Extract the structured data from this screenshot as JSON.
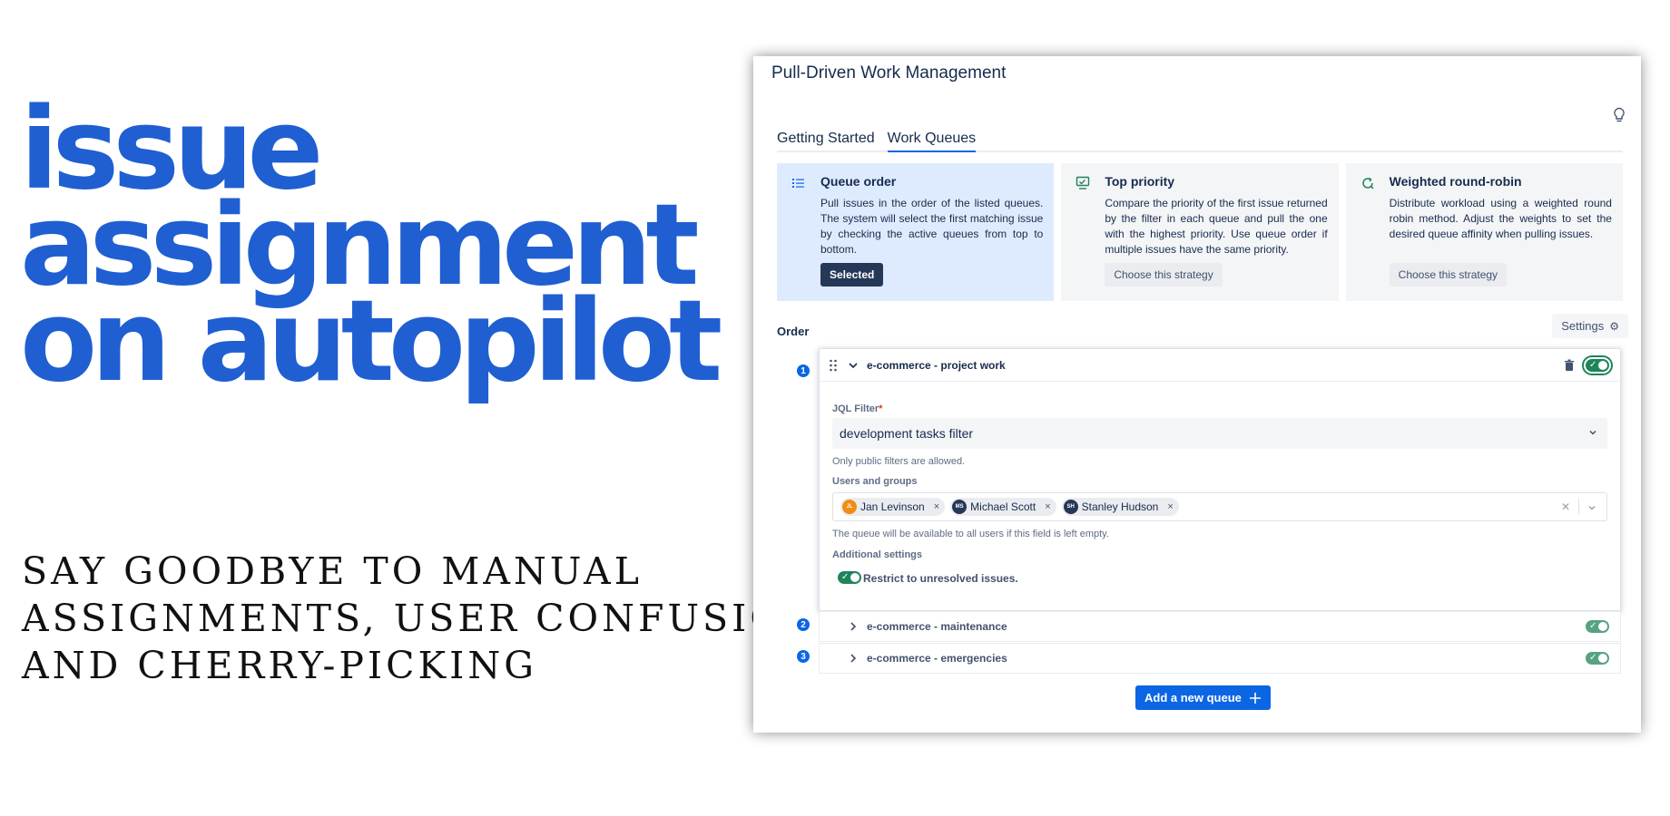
{
  "hero": {
    "headline": [
      "issue",
      "assignment",
      "on autopilot"
    ],
    "subline": [
      "SAY GOODBYE TO MANUAL",
      "ASSIGNMENTS, USER CONFUSION",
      "AND CHERRY-PICKING"
    ]
  },
  "app": {
    "title": "Pull-Driven Work Management",
    "tabs": [
      {
        "label": "Getting Started",
        "active": false
      },
      {
        "label": "Work Queues",
        "active": true
      }
    ],
    "strategies": [
      {
        "title": "Queue order",
        "icon": "list-icon",
        "description": "Pull issues in the order of the listed queues. The system will select the first matching issue by checking the active queues from top to bottom.",
        "button": "Selected",
        "selected": true
      },
      {
        "title": "Top priority",
        "icon": "priority-monitor-icon",
        "description": "Compare the priority of the first issue returned by the filter in each queue and pull the one with the highest priority. Use queue order if multiple issues have the same priority.",
        "button": "Choose this strategy",
        "selected": false
      },
      {
        "title": "Weighted round-robin",
        "icon": "round-robin-icon",
        "description": "Distribute workload using a weighted round robin method. Adjust the weights to set the desired queue affinity when pulling issues.",
        "button": "Choose this strategy",
        "selected": false
      }
    ],
    "order_label": "Order",
    "settings_label": "Settings",
    "queues": [
      {
        "number": "1",
        "name": "e-commerce - project work",
        "expanded": true,
        "enabled": true,
        "jql_label": "JQL Filter",
        "jql_value": "development tasks filter",
        "jql_help": "Only public filters are allowed.",
        "users_label": "Users and groups",
        "users": [
          {
            "initials": "JL",
            "name": "Jan Levinson",
            "color": "#f18d13"
          },
          {
            "initials": "MS",
            "name": "Michael Scott",
            "color": "#253858"
          },
          {
            "initials": "SH",
            "name": "Stanley Hudson",
            "color": "#253858"
          }
        ],
        "users_help": "The queue will be available to all users if this field is left empty.",
        "additional_label": "Additional settings",
        "restrict_label": "Restrict to unresolved issues.",
        "restrict_enabled": true
      },
      {
        "number": "2",
        "name": "e-commerce - maintenance",
        "expanded": false,
        "enabled": true
      },
      {
        "number": "3",
        "name": "e-commerce - emergencies",
        "expanded": false,
        "enabled": true
      }
    ],
    "add_button": "Add a new queue",
    "colors": {
      "brand": "#1f5fd1",
      "primary": "#0c66e4",
      "success": "#1f845a",
      "selected_bg": "#deebff"
    }
  }
}
